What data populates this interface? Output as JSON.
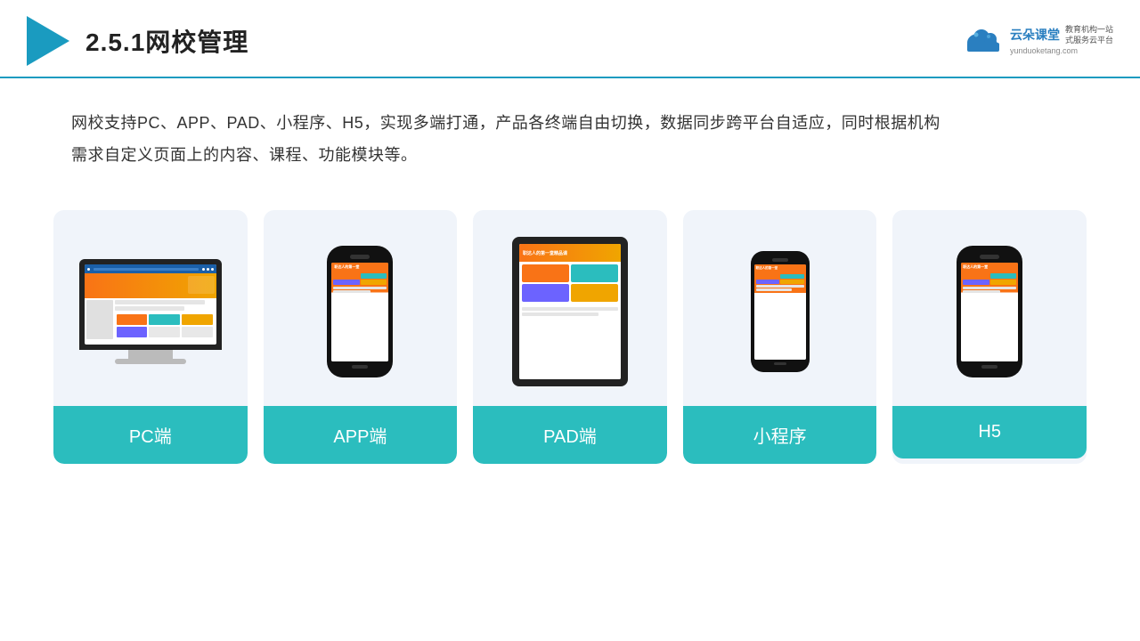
{
  "header": {
    "title": "2.5.1网校管理",
    "brand": {
      "name": "云朵课堂",
      "url": "yunduoketang.com",
      "slogan1": "教育机构一站",
      "slogan2": "式服务云平台"
    }
  },
  "description": {
    "line1": "网校支持PC、APP、PAD、小程序、H5，实现多端打通，产品各终端自由切换，数据同步跨平台自适应，同时根据机构",
    "line2": "需求自定义页面上的内容、课程、功能模块等。"
  },
  "cards": [
    {
      "label": "PC端",
      "type": "pc"
    },
    {
      "label": "APP端",
      "type": "phone"
    },
    {
      "label": "PAD端",
      "type": "tablet"
    },
    {
      "label": "小程序",
      "type": "mini-phone"
    },
    {
      "label": "H5",
      "type": "phone2"
    }
  ]
}
